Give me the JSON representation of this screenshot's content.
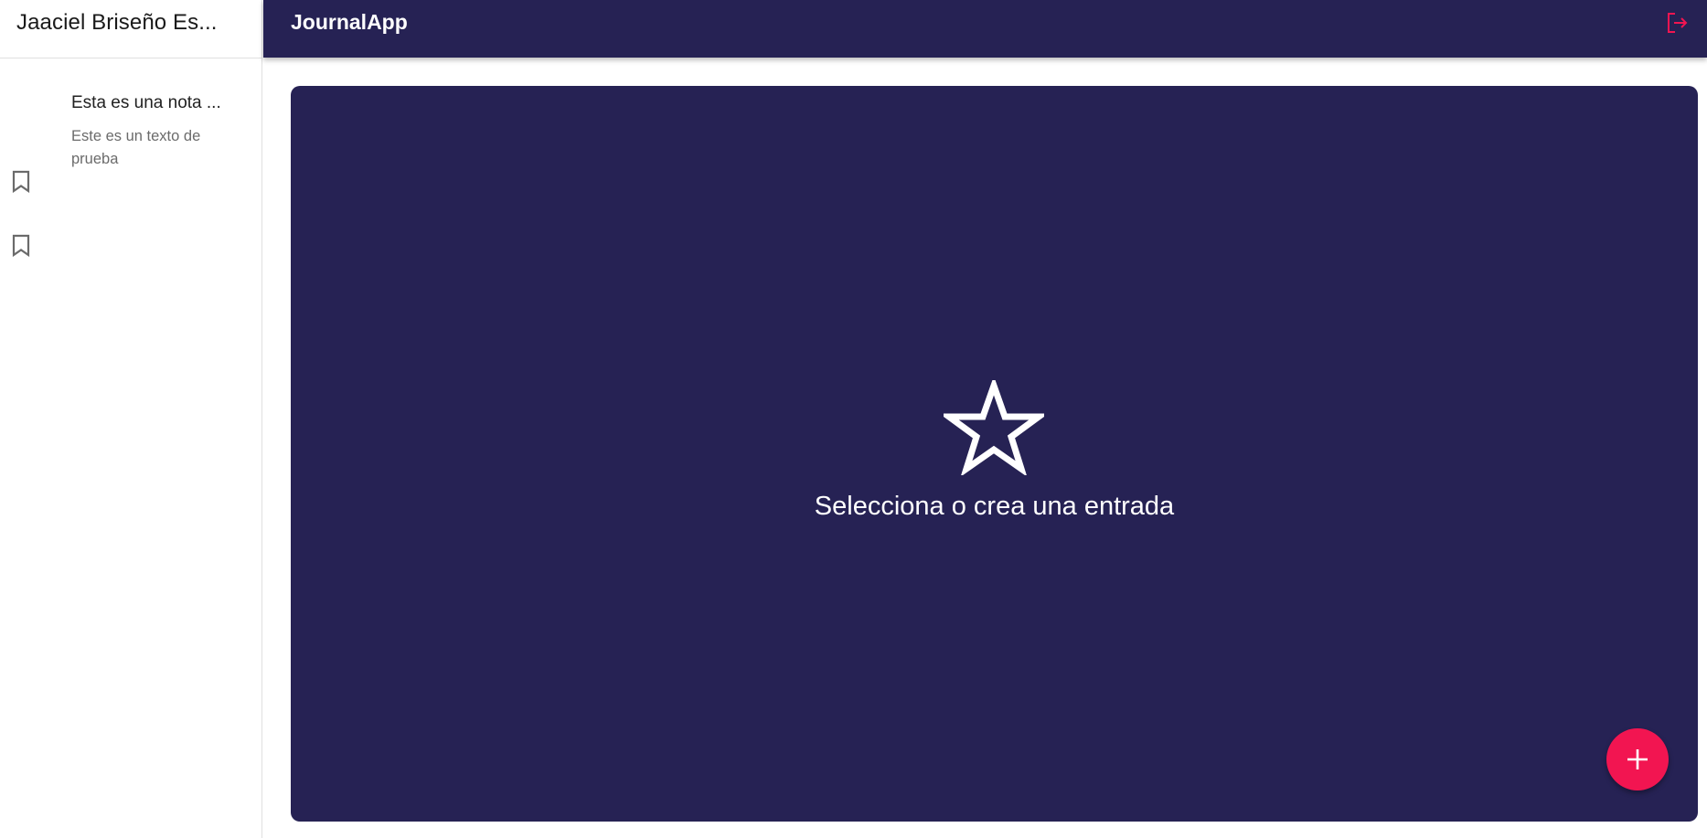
{
  "sidebar": {
    "user_name": "Jaaciel Briseño Es...",
    "notes": [
      {
        "title": "Esta es una nota ...",
        "body": "Este es un texto de prueba",
        "icon": "bookmark-icon"
      },
      {
        "title": "",
        "body": "",
        "icon": "bookmark-icon"
      }
    ]
  },
  "topbar": {
    "title": "JournalApp",
    "logout_icon": "logout-icon"
  },
  "main": {
    "empty_message": "Selecciona o crea una entrada",
    "empty_icon": "star-outline-icon",
    "fab_icon": "add-icon"
  },
  "colors": {
    "primary": "#262254",
    "accent": "#f21551",
    "sidebar_bg": "#ffffff",
    "text_primary": "#222222",
    "text_secondary": "#6b6b6b"
  }
}
